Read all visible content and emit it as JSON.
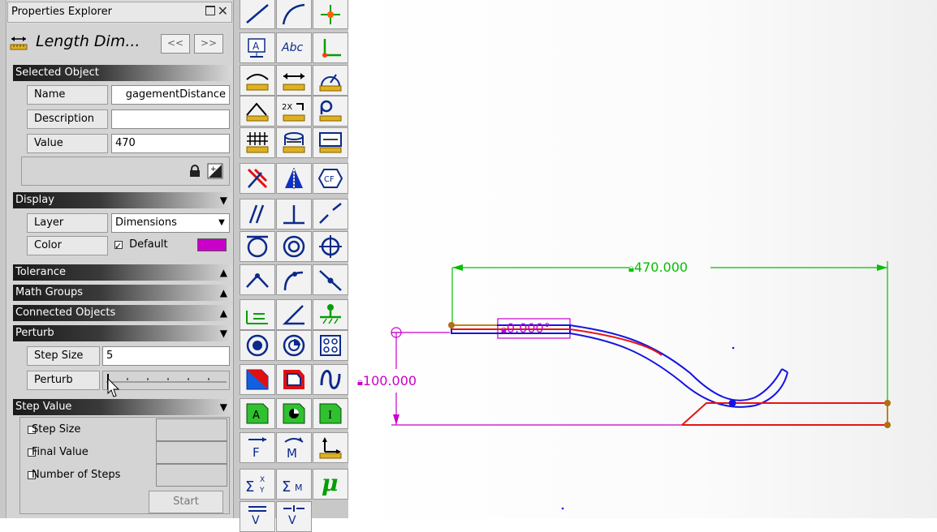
{
  "panel": {
    "title": "Properties Explorer",
    "object_title": "Length Dim...",
    "nav_prev": "<<",
    "nav_next": ">>",
    "selected_object": {
      "header": "Selected Object",
      "name_label": "Name",
      "name_value": "gagementDistance",
      "description_label": "Description",
      "description_value": "",
      "value_label": "Value",
      "value_value": "470"
    },
    "display": {
      "header": "Display",
      "layer_label": "Layer",
      "layer_value": "Dimensions",
      "color_label": "Color",
      "color_default_label": "Default",
      "color_swatch": "#c800c8"
    },
    "collapsed_sections": [
      "Tolerance",
      "Math Groups",
      "Connected Objects"
    ],
    "perturb": {
      "header": "Perturb",
      "step_size_label": "Step Size",
      "step_size_value": "5",
      "perturb_label": "Perturb"
    },
    "step_value": {
      "header": "Step Value",
      "options": [
        "Step Size",
        "Final Value",
        "Number of Steps"
      ],
      "start_label": "Start"
    }
  },
  "toolbar": {
    "abc_label": "Abc",
    "mu_label": "μ"
  },
  "canvas": {
    "horizontal_dim": "470.000",
    "vertical_dim": "100.000",
    "angle_dim": "0.000°",
    "colors": {
      "dimension_green": "#00c000",
      "dimension_magenta": "#c800c8",
      "part_blue": "#1414e6",
      "part_red": "#e61414",
      "point_orange": "#c08020"
    }
  }
}
